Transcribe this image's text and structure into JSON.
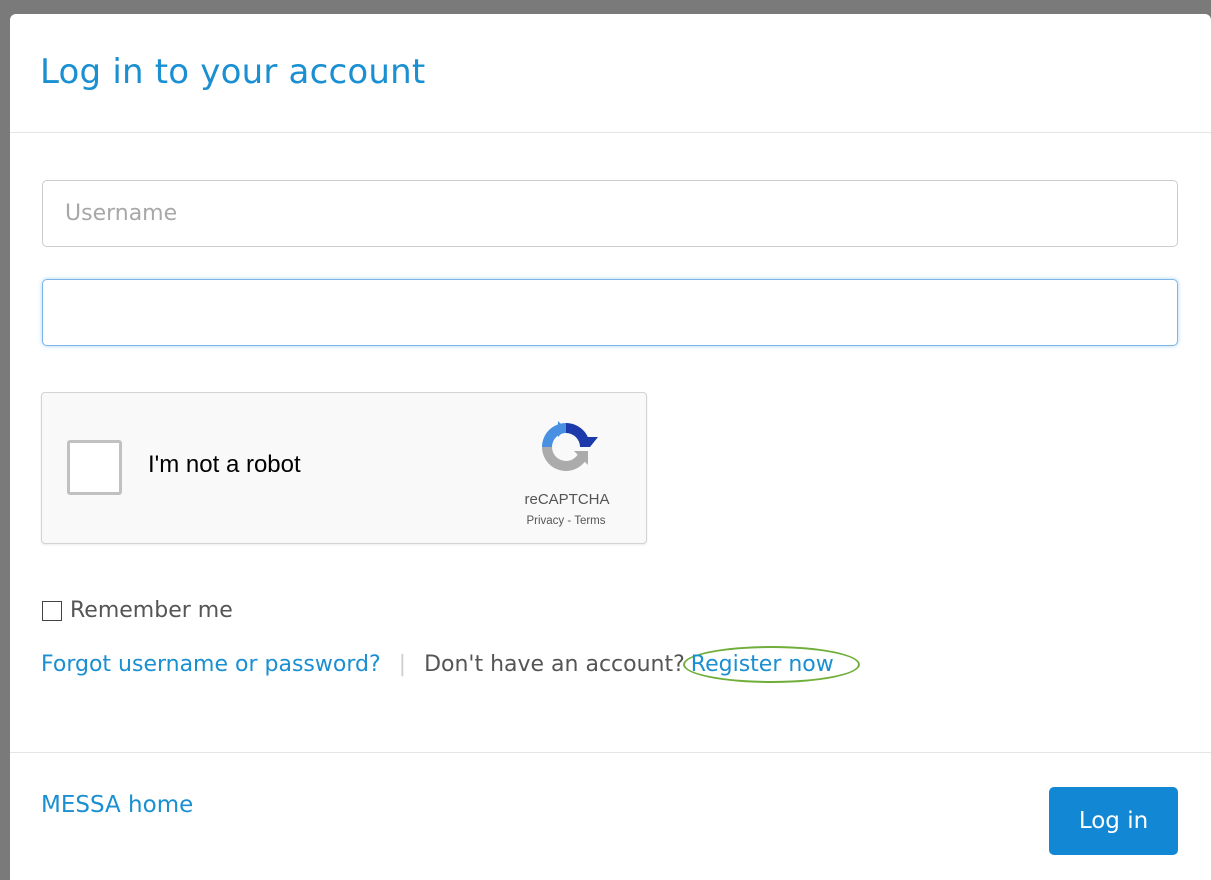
{
  "modal": {
    "title": "Log in to your account"
  },
  "form": {
    "username_placeholder": "Username",
    "username_value": "",
    "password_placeholder": "",
    "password_value": ""
  },
  "recaptcha": {
    "label": "I'm not a robot",
    "brand": "reCAPTCHA",
    "links": "Privacy - Terms",
    "checked": false
  },
  "remember": {
    "label": "Remember me",
    "checked": false
  },
  "links": {
    "forgot": "Forgot username or password?",
    "separator": "|",
    "no_account": "Don't have an account?",
    "register": "Register now"
  },
  "footer": {
    "home_link": "MESSA home",
    "login_button": "Log in"
  },
  "colors": {
    "accent": "#1a8fd1",
    "button": "#1288d4",
    "highlight_circle": "#6fae3a"
  }
}
